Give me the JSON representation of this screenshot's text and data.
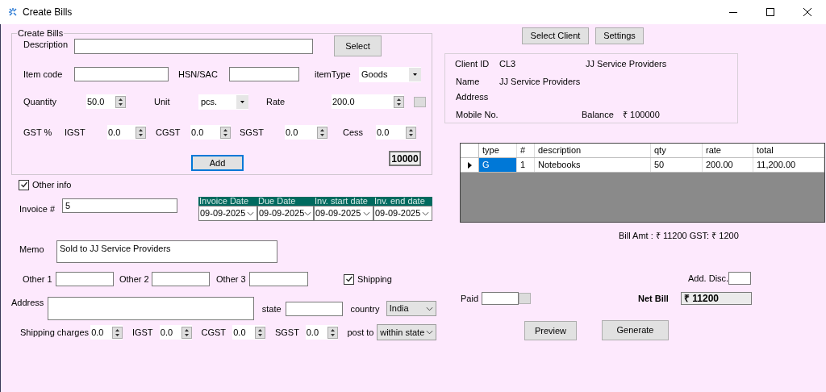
{
  "window": {
    "title": "Create Bills"
  },
  "item_group": {
    "legend": "Create Bills",
    "fields": [
      {
        "kind": "label",
        "text": "Description"
      },
      {
        "kind": "input"
      },
      {
        "kind": "button",
        "text": "Select",
        "focused": false
      },
      {
        "kind": "label",
        "text": "Item code"
      },
      {
        "kind": "input"
      },
      {
        "kind": "label",
        "text": "HSN/SAC"
      },
      {
        "kind": "input"
      },
      {
        "kind": "label",
        "text": "itemType"
      },
      {
        "kind": "combo",
        "value": "Goods"
      },
      {
        "kind": "label",
        "text": "Quantity"
      },
      {
        "kind": "spin",
        "value": "50.0"
      },
      {
        "kind": "label",
        "text": "Unit"
      },
      {
        "kind": "combo",
        "value": "pcs."
      },
      {
        "kind": "label",
        "text": "Rate"
      },
      {
        "kind": "spin",
        "value": "200.0"
      },
      {
        "kind": "small_button"
      },
      {
        "kind": "label",
        "text": "GST %"
      },
      {
        "kind": "label",
        "text": "IGST"
      },
      {
        "kind": "spin",
        "value": "0.0"
      },
      {
        "kind": "label",
        "text": "CGST"
      },
      {
        "kind": "spin",
        "value": "0.0"
      },
      {
        "kind": "label",
        "text": "SGST"
      },
      {
        "kind": "spin",
        "value": "0.0"
      },
      {
        "kind": "label",
        "text": "Cess"
      },
      {
        "kind": "spin",
        "value": "0.0"
      },
      {
        "kind": "button",
        "text": "Add",
        "focused": true
      },
      {
        "kind": "total",
        "text": "10000"
      }
    ]
  },
  "details": {
    "fields": [
      {
        "kind": "checkbox",
        "label": "Other info",
        "checked": true
      },
      {
        "kind": "label",
        "text": "Invoice #"
      },
      {
        "kind": "input",
        "value": "5"
      },
      {
        "kind": "dates",
        "columns": [
          {
            "label": "Invoice Date",
            "value": "09-09-2025"
          },
          {
            "label": "Due Date",
            "value": "09-09-2025"
          },
          {
            "label": "Inv. start date",
            "value": "09-09-2025"
          },
          {
            "label": "Inv. end date",
            "value": "09-09-2025"
          }
        ]
      },
      {
        "kind": "label",
        "text": "Memo"
      },
      {
        "kind": "textarea",
        "value": "Sold to JJ Service Providers"
      },
      {
        "kind": "label",
        "text": "Other 1"
      },
      {
        "kind": "input"
      },
      {
        "kind": "label",
        "text": "Other 2"
      },
      {
        "kind": "input"
      },
      {
        "kind": "label",
        "text": "Other 3"
      },
      {
        "kind": "input"
      },
      {
        "kind": "checkbox",
        "label": "Shipping",
        "checked": true
      },
      {
        "kind": "label",
        "text": "Address"
      },
      {
        "kind": "textarea"
      },
      {
        "kind": "label",
        "text": "state"
      },
      {
        "kind": "input"
      },
      {
        "kind": "label",
        "text": "country"
      },
      {
        "kind": "combo",
        "value": "India"
      },
      {
        "kind": "label",
        "text": "Shipping charges"
      },
      {
        "kind": "spin",
        "value": "0.0"
      },
      {
        "kind": "label",
        "text": "IGST"
      },
      {
        "kind": "spin",
        "value": "0.0"
      },
      {
        "kind": "label",
        "text": "CGST"
      },
      {
        "kind": "spin",
        "value": "0.0"
      },
      {
        "kind": "label",
        "text": "SGST"
      },
      {
        "kind": "spin",
        "value": "0.0"
      },
      {
        "kind": "label",
        "text": "post to"
      },
      {
        "kind": "combo",
        "value": "within state"
      }
    ]
  },
  "client_actions": {
    "fields": [
      {
        "kind": "button",
        "text": "Select Client",
        "focused": false
      },
      {
        "kind": "button",
        "text": "Settings",
        "focused": false
      }
    ]
  },
  "client": {
    "fields": [
      {
        "kind": "label",
        "text": "Client ID"
      },
      {
        "kind": "label",
        "text": "CL3"
      },
      {
        "kind": "label",
        "text": "JJ Service Providers"
      },
      {
        "kind": "label",
        "text": "Name"
      },
      {
        "kind": "label",
        "text": "JJ Service Providers"
      },
      {
        "kind": "label",
        "text": "Address"
      },
      {
        "kind": "label",
        "text": "Mobile No."
      },
      {
        "kind": "label",
        "text": "Balance"
      },
      {
        "kind": "label",
        "text": "₹ 100000"
      }
    ]
  },
  "grid": {
    "columns": [
      "type",
      "#",
      "description",
      "qty",
      "rate",
      "total"
    ],
    "rows": [
      {
        "current": true,
        "cells": [
          {
            "text": "G",
            "selected": true
          },
          {
            "text": "1",
            "selected": false
          },
          {
            "text": "Notebooks",
            "selected": false
          },
          {
            "text": "50",
            "selected": false
          },
          {
            "text": "200.00",
            "selected": false
          },
          {
            "text": "11,200.00",
            "selected": false
          }
        ]
      }
    ]
  },
  "summary": {
    "fields": [
      {
        "kind": "label",
        "text": "Bill Amt : ₹ 11200  GST: ₹ 1200"
      },
      {
        "kind": "label",
        "text": "Add. Disc."
      },
      {
        "kind": "input"
      },
      {
        "kind": "label",
        "text": "Paid"
      },
      {
        "kind": "input"
      },
      {
        "kind": "small_button"
      },
      {
        "kind": "strong",
        "text": "Net Bill"
      },
      {
        "kind": "readonly",
        "value": "₹ 11200"
      },
      {
        "kind": "button",
        "text": "Preview",
        "focused": false
      },
      {
        "kind": "button",
        "text": "Generate",
        "focused": false
      }
    ]
  }
}
